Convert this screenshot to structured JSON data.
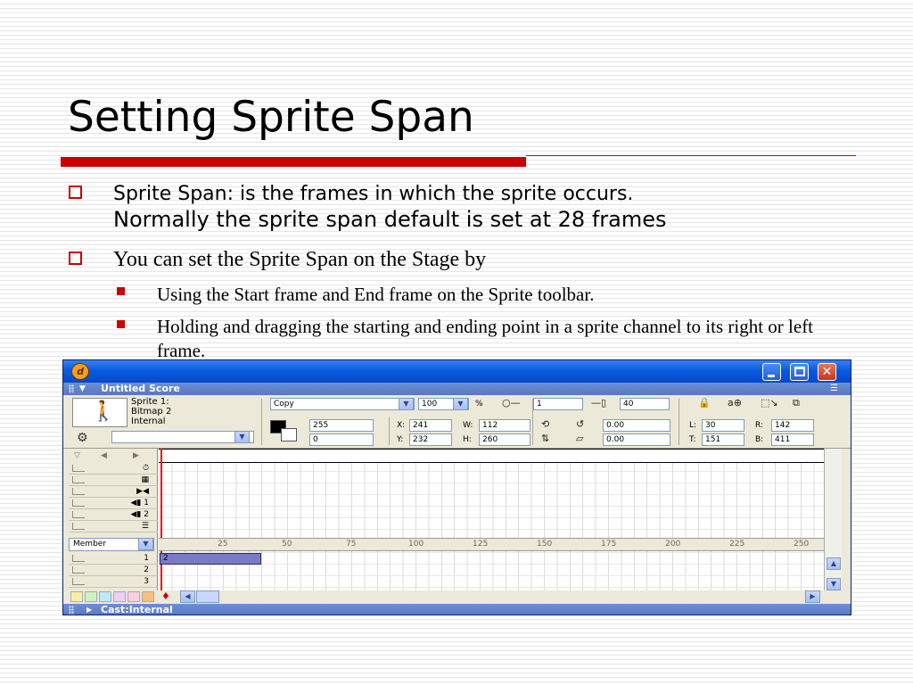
{
  "slide": {
    "title": "Setting Sprite Span",
    "bullets": {
      "b1_line1": "Sprite Span: is the frames in which the sprite occurs.",
      "b1_line2": "Normally the sprite span default is set at 28 frames",
      "b2": "You can set the Sprite Span on the Stage by",
      "b3": "Using the Start frame and End frame on the Sprite toolbar.",
      "b4": "Holding and dragging the starting and ending point in a sprite channel to its right or left frame."
    }
  },
  "colors": {
    "accent_red": "#cc0000",
    "title_blue": "#0a5ae0",
    "sprite_bar": "#7a7ac8"
  },
  "score_window": {
    "app_icon": "director-logo-icon",
    "title": "Untitled Score",
    "close_glyph": "✕",
    "sprite_toolbar": {
      "sprite_name": "Sprite 1: Bitmap 2",
      "cast": "Internal",
      "ink": "Copy",
      "blend": "100",
      "blend_unit": "%",
      "start_frame": "1",
      "end_frame": "40",
      "fg_value": "255",
      "bg_value": "0",
      "x_label": "X:",
      "x": "241",
      "y_label": "Y:",
      "y": "232",
      "w_label": "W:",
      "w": "112",
      "h_label": "H:",
      "h": "260",
      "rotation": "0.00",
      "skew": "0.00",
      "l_label": "L:",
      "l": "30",
      "t_label": "T:",
      "t": "151",
      "r_label": "R:",
      "r": "142",
      "b_label": "B:",
      "b": "411"
    },
    "channels": {
      "sound1": "1",
      "sound2": "2",
      "member_select": "Member",
      "sprite_channels": [
        "1",
        "2",
        "3"
      ]
    },
    "ruler_ticks": [
      "25",
      "50",
      "75",
      "100",
      "125",
      "150",
      "175",
      "200",
      "225",
      "250"
    ],
    "sprite_bar_label": "2",
    "cast_panel_title": "Cast:Internal"
  }
}
